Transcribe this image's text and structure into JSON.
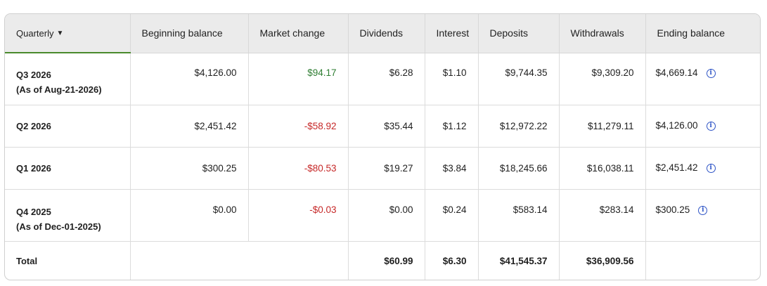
{
  "header": {
    "period_label": "Quarterly",
    "caret": "▼",
    "columns": [
      "Beginning balance",
      "Market change",
      "Dividends",
      "Interest",
      "Deposits",
      "Withdrawals",
      "Ending balance"
    ]
  },
  "rows": [
    {
      "period": "Q3 2026",
      "as_of": "(As of Aug-21-2026)",
      "beginning": "$4,126.00",
      "market": "$94.17",
      "dividends": "$6.28",
      "interest": "$1.10",
      "deposits": "$9,744.35",
      "withdrawals": "$9,309.20",
      "ending": "$4,669.14"
    },
    {
      "period": "Q2 2026",
      "beginning": "$2,451.42",
      "market": "-$58.92",
      "dividends": "$35.44",
      "interest": "$1.12",
      "deposits": "$12,972.22",
      "withdrawals": "$11,279.11",
      "ending": "$4,126.00"
    },
    {
      "period": "Q1 2026",
      "beginning": "$300.25",
      "market": "-$80.53",
      "dividends": "$19.27",
      "interest": "$3.84",
      "deposits": "$18,245.66",
      "withdrawals": "$16,038.11",
      "ending": "$2,451.42"
    },
    {
      "period": "Q4 2025",
      "as_of": "(As of Dec-01-2025)",
      "beginning": "$0.00",
      "market": "-$0.03",
      "dividends": "$0.00",
      "interest": "$0.24",
      "deposits": "$583.14",
      "withdrawals": "$283.14",
      "ending": "$300.25"
    }
  ],
  "total": {
    "label": "Total",
    "dividends": "$60.99",
    "interest": "$6.30",
    "deposits": "$41,545.37",
    "withdrawals": "$36,909.56"
  },
  "icons": {
    "info": "i"
  },
  "colors": {
    "positive": "#2e7d32",
    "negative": "#c62828",
    "accent_underline": "#4a8a2c",
    "info_icon": "#2f55c6",
    "header_bg": "#ebebeb"
  }
}
